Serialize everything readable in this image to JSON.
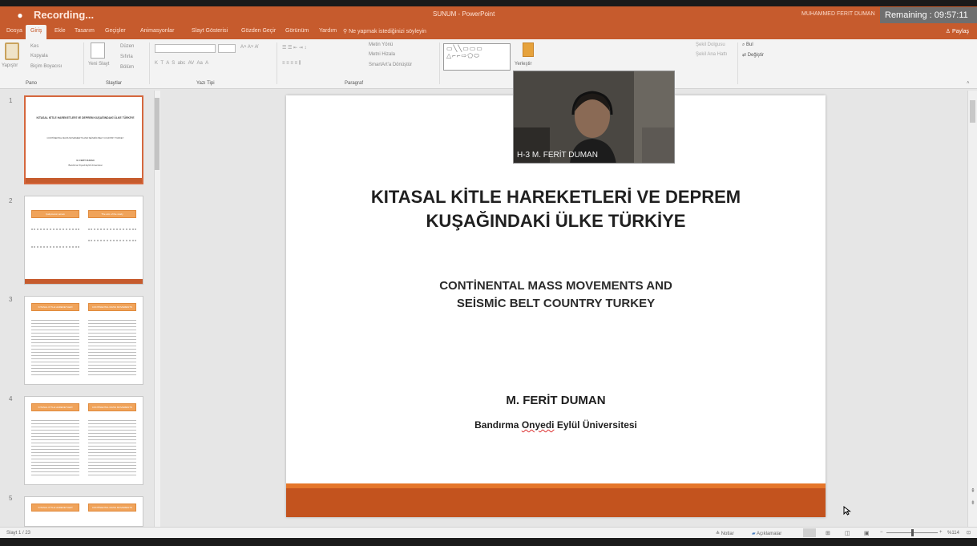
{
  "app": {
    "recording_label": "Recording...",
    "window_title": "SUNUM - PowerPoint",
    "user_name": "MUHAMMED FERIT DUMAN",
    "timer": "Remaining : 09:57:11"
  },
  "menu": {
    "tabs": [
      "Dosya",
      "Giriş",
      "Ekle",
      "Tasarım",
      "Geçişler",
      "Animasyonlar",
      "Slayt Gösterisi",
      "Gözden Geçir",
      "Görünüm",
      "Yardım"
    ],
    "tell_me": "Ne yapmak istediğinizi söyleyin",
    "share": "Paylaş"
  },
  "ribbon": {
    "groups": [
      "Pano",
      "Slaytlar",
      "Yazı Tipi",
      "Paragraf"
    ],
    "clipboard": {
      "paste": "Yapıştır",
      "cut": "Kes",
      "copy": "Kopyala",
      "format_painter": "Biçim Boyacısı"
    },
    "slides": {
      "new_slide": "Yeni Slayt",
      "layout": "Düzen",
      "reset": "Sıfırla",
      "section": "Bölüm"
    },
    "paragraph": {
      "text_direction": "Metin Yönü",
      "align_text": "Metni Hizala",
      "smartart": "SmartArt'a Dönüştür"
    },
    "drawing": {
      "arrange": "Yerleştir",
      "shape_fill": "Şekil Dolgusu",
      "shape_outline": "Şekil Ana Hattı"
    },
    "editing": {
      "find": "Bul",
      "replace": "Değiştir"
    }
  },
  "thumbnails": [
    {
      "num": "1",
      "title": "KITASAL KİTLE HAREKETLERİ VE DEPREM KUŞAĞINDAKİ ÜLKE TÜRKİYE",
      "subtitle": "CONTİNENTAL MASS MOVEMENTS AND SEİSMİC BELT COUNTRY TURKEY",
      "author": "M. FERİT DUMAN",
      "inst": "Bandırma Onyedi Eylül Üniversitesi"
    },
    {
      "num": "2",
      "box_left": "Çalışmanın amacı",
      "box_right": "The aim of the study"
    },
    {
      "num": "3",
      "box_left": "KITASAL KİTLE HAREKETLERİ",
      "box_right": "CONTİNENTAL MASS MOVEMENTS"
    },
    {
      "num": "4",
      "box_left": "KITASAL KİTLE HAREKETLERİ",
      "box_right": "CONTİNENTAL MASS MOVEMENTS"
    },
    {
      "num": "5",
      "box_left": "KITASAL KİTLE HAREKETLERİ",
      "box_right": "CONTİNENTAL MASS MOVEMENTS"
    }
  ],
  "slide": {
    "title_line1": "KITASAL KİTLE HAREKETLERİ VE DEPREM",
    "title_line2": "KUŞAĞINDAKİ ÜLKE TÜRKİYE",
    "subtitle_line1": "CONTİNENTAL MASS MOVEMENTS AND",
    "subtitle_line2": "SEİSMİC BELT COUNTRY TURKEY",
    "author": "M. FERİT DUMAN",
    "inst_1": "Bandırma",
    "inst_2": "Onyedi",
    "inst_3": "Eylül Üniversitesi"
  },
  "webcam": {
    "label": "H-3 M. FERİT DUMAN"
  },
  "status": {
    "slide_count": "Slayt 1 / 23",
    "notes": "Notlar",
    "comments": "Açıklamalar",
    "zoom": "%114"
  },
  "colors": {
    "accent": "#c65b2d",
    "slide_bar": "#c3531e",
    "thumb_box": "#f0a35a"
  }
}
